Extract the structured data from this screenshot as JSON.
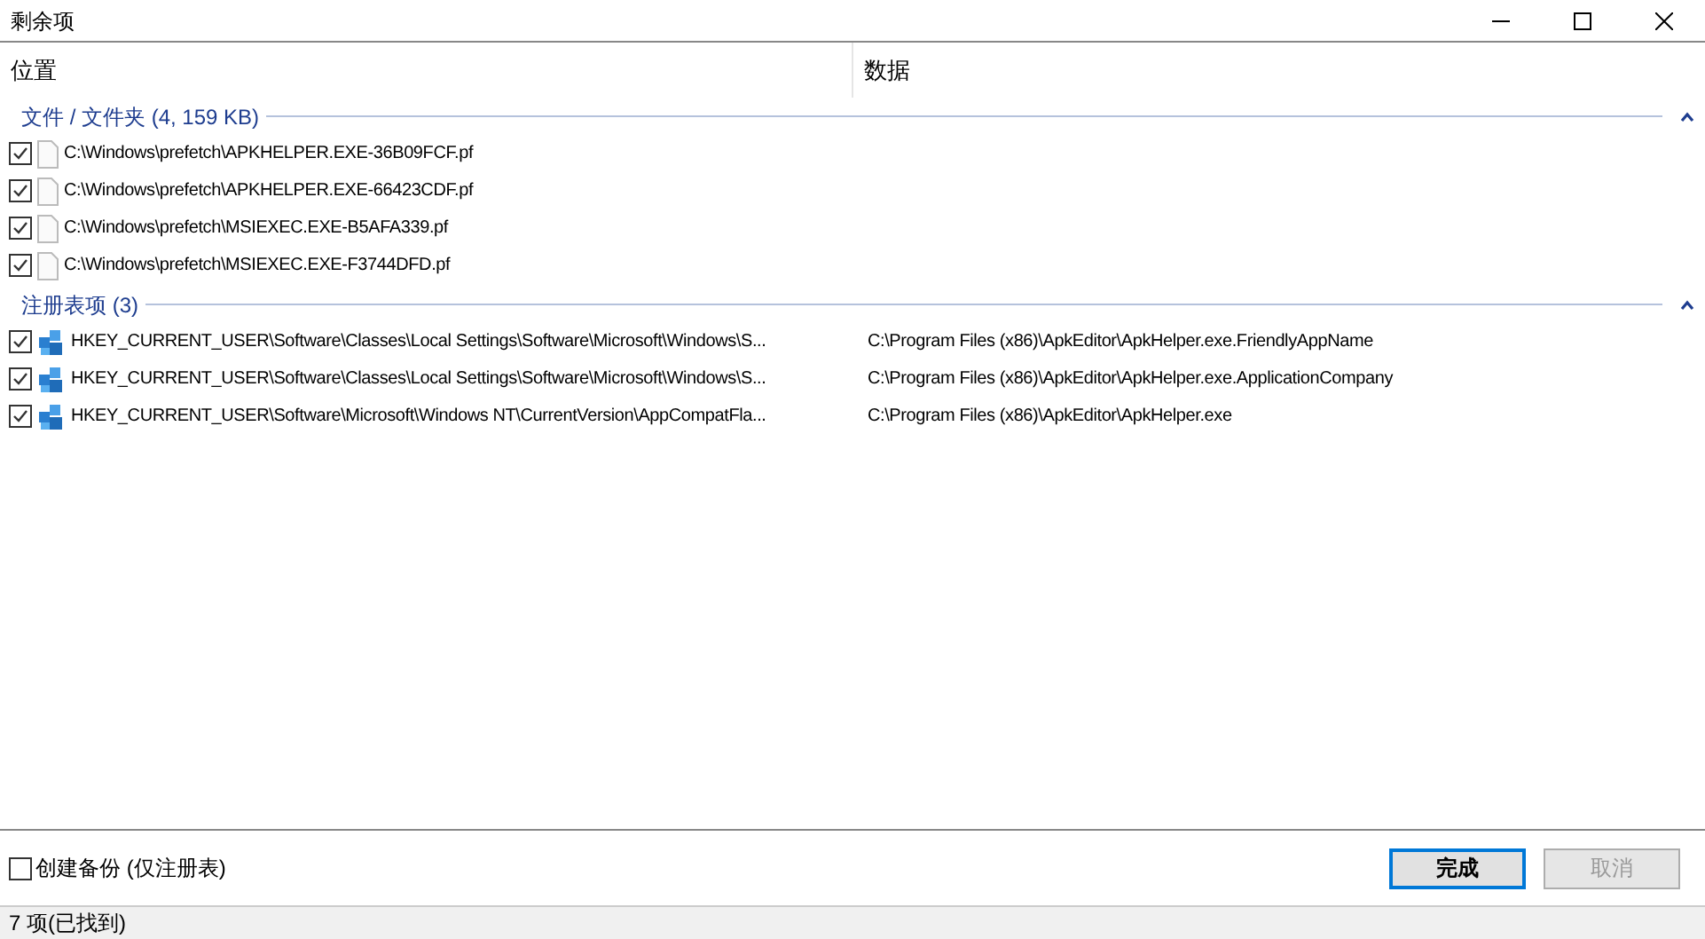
{
  "window": {
    "title": "剩余项",
    "controls": [
      {
        "kind": "min"
      },
      {
        "kind": "max"
      },
      {
        "kind": "close"
      }
    ]
  },
  "columns": [
    "位置",
    "数据"
  ],
  "groups": [
    {
      "title": "文件 / 文件夹 (4, 159 KB)",
      "expanded": true,
      "items": [
        {
          "kind": "file",
          "checked": true,
          "location": "C:\\Windows\\prefetch\\APKHELPER.EXE-36B09FCF.pf"
        },
        {
          "kind": "file",
          "checked": true,
          "location": "C:\\Windows\\prefetch\\APKHELPER.EXE-66423CDF.pf"
        },
        {
          "kind": "file",
          "checked": true,
          "location": "C:\\Windows\\prefetch\\MSIEXEC.EXE-B5AFA339.pf"
        },
        {
          "kind": "file",
          "checked": true,
          "location": "C:\\Windows\\prefetch\\MSIEXEC.EXE-F3744DFD.pf"
        }
      ]
    },
    {
      "title": "注册表项 (3)",
      "expanded": true,
      "items": [
        {
          "kind": "registry",
          "checked": true,
          "location": "HKEY_CURRENT_USER\\Software\\Classes\\Local Settings\\Software\\Microsoft\\Windows\\S...",
          "data": "C:\\Program Files (x86)\\ApkEditor\\ApkHelper.exe.FriendlyAppName"
        },
        {
          "kind": "registry",
          "checked": true,
          "location": "HKEY_CURRENT_USER\\Software\\Classes\\Local Settings\\Software\\Microsoft\\Windows\\S...",
          "data": "C:\\Program Files (x86)\\ApkEditor\\ApkHelper.exe.ApplicationCompany"
        },
        {
          "kind": "registry",
          "checked": true,
          "location": "HKEY_CURRENT_USER\\Software\\Microsoft\\Windows NT\\CurrentVersion\\AppCompatFla...",
          "data": "C:\\Program Files (x86)\\ApkEditor\\ApkHelper.exe"
        }
      ]
    }
  ],
  "backup": {
    "label": "创建备份 (仅注册表)",
    "checked": false
  },
  "buttons": [
    {
      "label": "完成",
      "disabled": false,
      "default": true
    },
    {
      "label": "取消",
      "disabled": true,
      "default": false
    }
  ],
  "status_bar": "7 项(已找到)"
}
